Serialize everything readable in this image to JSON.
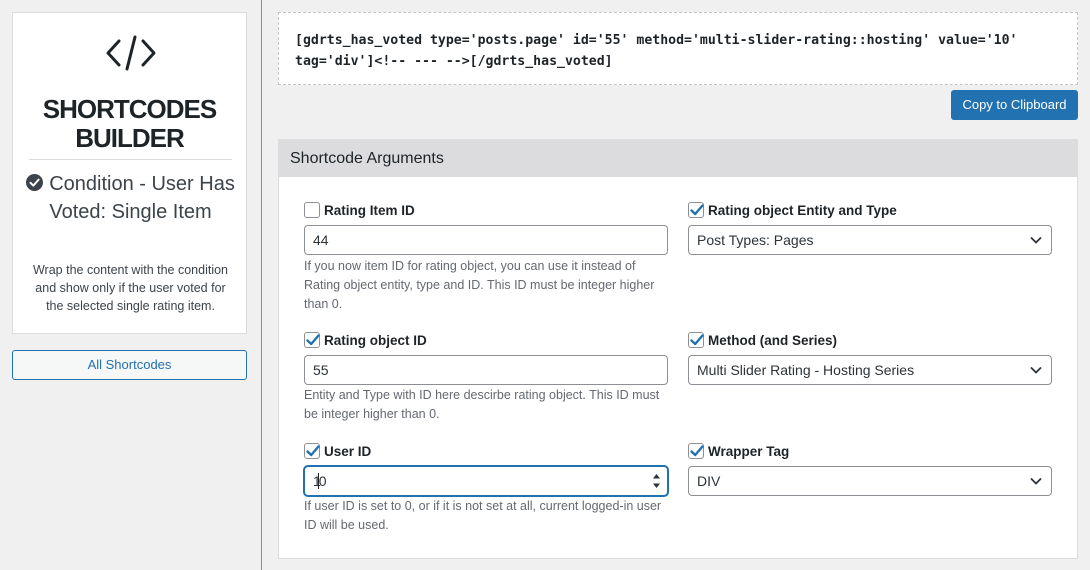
{
  "sidebar": {
    "builder_title_line1": "SHORTCODES",
    "builder_title_line2": "BUILDER",
    "condition_title": "Condition - User Has Voted: Single Item",
    "condition_description": "Wrap the content with the condition and show only if the user voted for the selected single rating item.",
    "all_shortcodes_label": "All Shortcodes",
    "icons": [
      "code-icon",
      "check-circle-icon"
    ]
  },
  "code": {
    "shortcode_text": "[gdrts_has_voted type='posts.page' id='55' method='multi-slider-rating::hosting' value='10' tag='div']<!-- --- -->[/gdrts_has_voted]",
    "copy_label": "Copy to Clipboard"
  },
  "args": {
    "header": "Shortcode Arguments",
    "rating_item_id": {
      "label": "Rating Item ID",
      "checked": false,
      "value": "44",
      "help": "If you now item ID for rating object, you can use it instead of Rating object entity, type and ID. This ID must be integer higher than 0."
    },
    "rating_object_entity": {
      "label": "Rating object Entity and Type",
      "checked": true,
      "selected": "Post Types: Pages"
    },
    "rating_object_id": {
      "label": "Rating object ID",
      "checked": true,
      "value": "55",
      "help": "Entity and Type with ID here descirbe rating object. This ID must be integer higher than 0."
    },
    "method": {
      "label": "Method (and Series)",
      "checked": true,
      "selected": "Multi Slider Rating - Hosting Series"
    },
    "user_id": {
      "label": "User ID",
      "checked": true,
      "value_before_caret": "1",
      "value_after_caret": "0",
      "help": "If user ID is set to 0, or if it is not set at all, current logged-in user ID will be used."
    },
    "wrapper_tag": {
      "label": "Wrapper Tag",
      "checked": true,
      "selected": "DIV"
    }
  },
  "colors": {
    "accent": "#2271b1",
    "checkmark": "#2271b1",
    "header_bg": "#dcdcde",
    "page_bg": "#f0f0f1"
  }
}
